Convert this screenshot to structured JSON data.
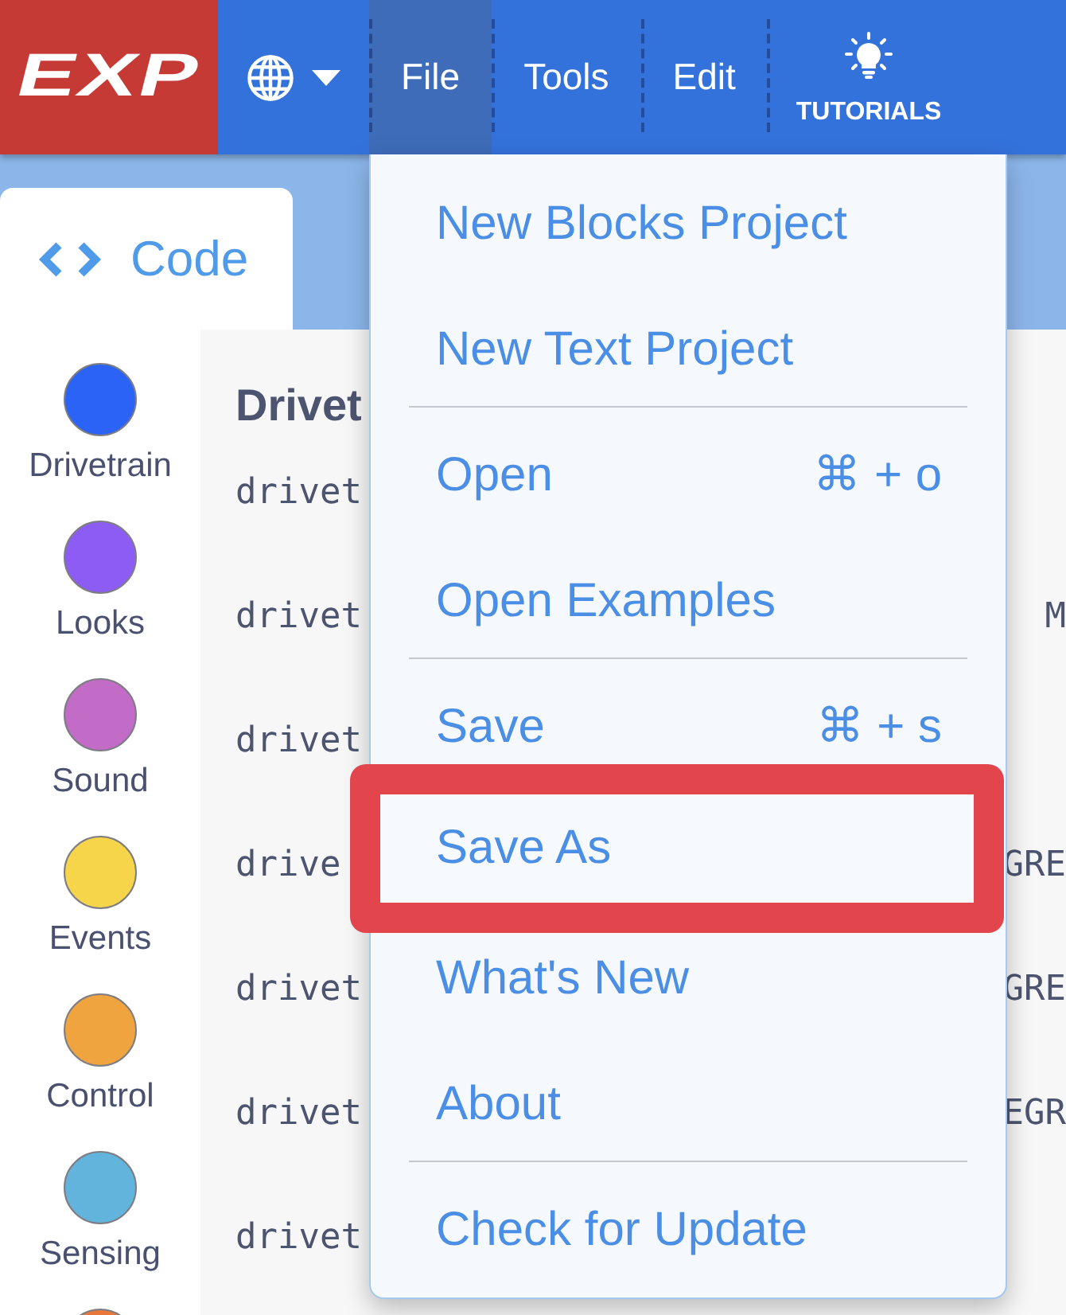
{
  "header": {
    "logo": "EXP",
    "nav": [
      {
        "label": "File",
        "selected": true
      },
      {
        "label": "Tools",
        "selected": false
      },
      {
        "label": "Edit",
        "selected": false
      }
    ],
    "tutorials": "TUTORIALS"
  },
  "editor_tabs": [
    {
      "label": "Code",
      "selected": true
    }
  ],
  "categories": [
    {
      "label": "Drivetrain",
      "color": "#2b63f6"
    },
    {
      "label": "Looks",
      "color": "#8c5cf5"
    },
    {
      "label": "Sound",
      "color": "#c26bc7"
    },
    {
      "label": "Events",
      "color": "#f7d54a"
    },
    {
      "label": "Control",
      "color": "#efa43f"
    },
    {
      "label": "Sensing",
      "color": "#63b4dd"
    },
    {
      "color": "#e8773a"
    }
  ],
  "code": {
    "heading": "Drivet",
    "lines": [
      {
        "left": "drivet"
      },
      {
        "left": "drivet",
        "right": "M"
      },
      {
        "left": "drivet"
      },
      {
        "left": "drive",
        "right": "GRE"
      },
      {
        "left": "drivet",
        "right": "GRE"
      },
      {
        "left": "drivet",
        "right": "EGR"
      },
      {
        "left": "drivet"
      }
    ]
  },
  "file_menu": {
    "sections": [
      [
        {
          "label": "New Blocks Project",
          "highlighted": false
        },
        {
          "label": "New Text Project",
          "highlighted": false
        }
      ],
      [
        {
          "label": "Open",
          "shortcut": "⌘ + o",
          "highlighted": false
        },
        {
          "label": "Open Examples",
          "highlighted": false
        }
      ],
      [
        {
          "label": "Save",
          "shortcut": "⌘ + s",
          "highlighted": false
        },
        {
          "label": "Save As",
          "highlighted": true
        },
        {
          "label": "What's New",
          "highlighted": false
        },
        {
          "label": "About",
          "highlighted": false
        }
      ],
      [
        {
          "label": "Check for Update",
          "highlighted": false
        }
      ]
    ]
  }
}
